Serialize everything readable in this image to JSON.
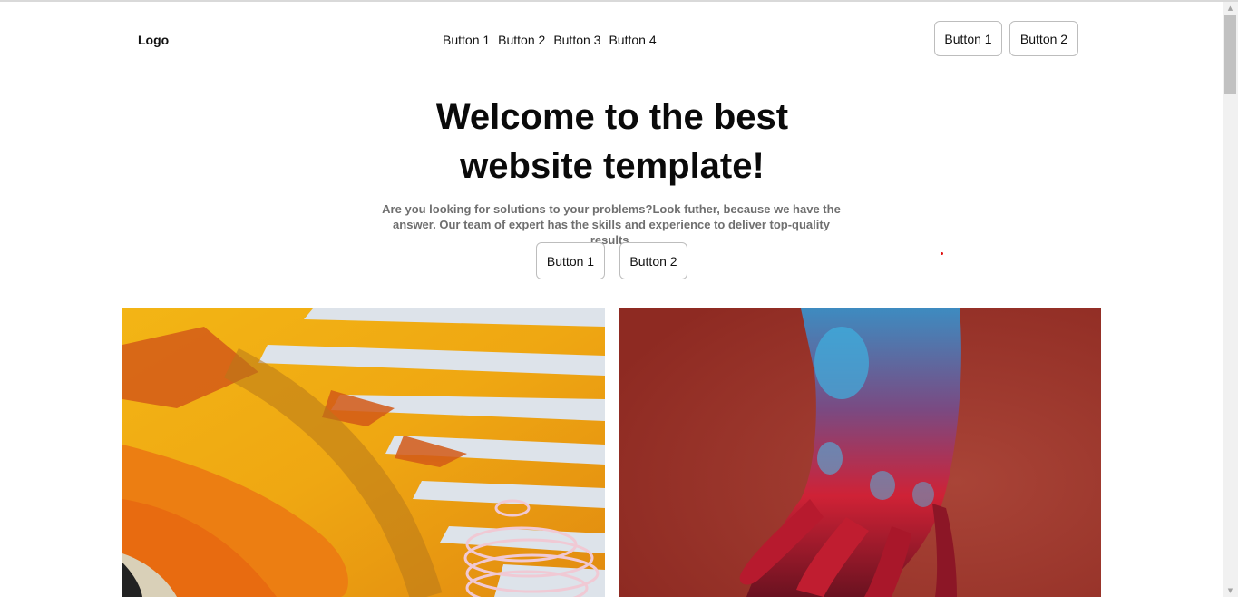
{
  "header": {
    "logo": "Logo",
    "nav": [
      "Button 1",
      "Button 2",
      "Button 3",
      "Button 4"
    ],
    "actions": [
      "Button 1",
      "Button 2"
    ]
  },
  "hero": {
    "title_line1": "Welcome to the best",
    "title_line2": "website template!",
    "subtitle_line1": "Are you looking for solutions to your problems?Look futher, because we have the",
    "subtitle_line2": "answer. Our team of expert has the skills and experience to deliver top-quality results.",
    "buttons": [
      "Button 1",
      "Button 2"
    ]
  },
  "colors": {
    "text": "#111111",
    "muted": "#6f6f6f",
    "border": "#bdbdbd",
    "accent_dot": "#e01010"
  }
}
